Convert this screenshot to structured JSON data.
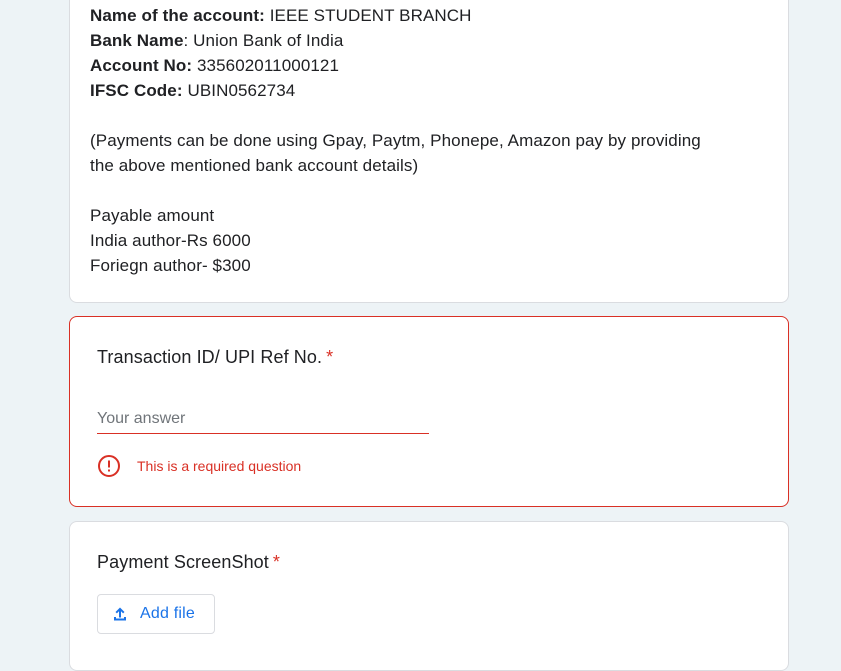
{
  "info": {
    "account_name_label": "Name of the account:",
    "account_name_value": "IEEE STUDENT BRANCH",
    "bank_name_label": "Bank Name",
    "bank_name_value": ": Union Bank of India",
    "account_no_label": "Account No:",
    "account_no_value": "335602011000121",
    "ifsc_label": "IFSC Code:",
    "ifsc_value": "UBIN0562734",
    "payment_note_line1": "(Payments can be done using Gpay, Paytm, Phonepe, Amazon pay by providing",
    "payment_note_line2": "the above mentioned bank account details)",
    "payable_heading": "Payable amount",
    "india_author": "India author-Rs 6000",
    "foreign_author": "Foriegn author- $300"
  },
  "transaction": {
    "title": "Transaction ID/ UPI Ref No.",
    "required_mark": "*",
    "placeholder": "Your answer",
    "value": "",
    "error": "This is a required question"
  },
  "screenshot": {
    "title": "Payment ScreenShot",
    "required_mark": "*",
    "add_file_label": "Add file"
  },
  "colors": {
    "error": "#d93025",
    "accent": "#1a73e8",
    "background": "#edf3f6"
  }
}
